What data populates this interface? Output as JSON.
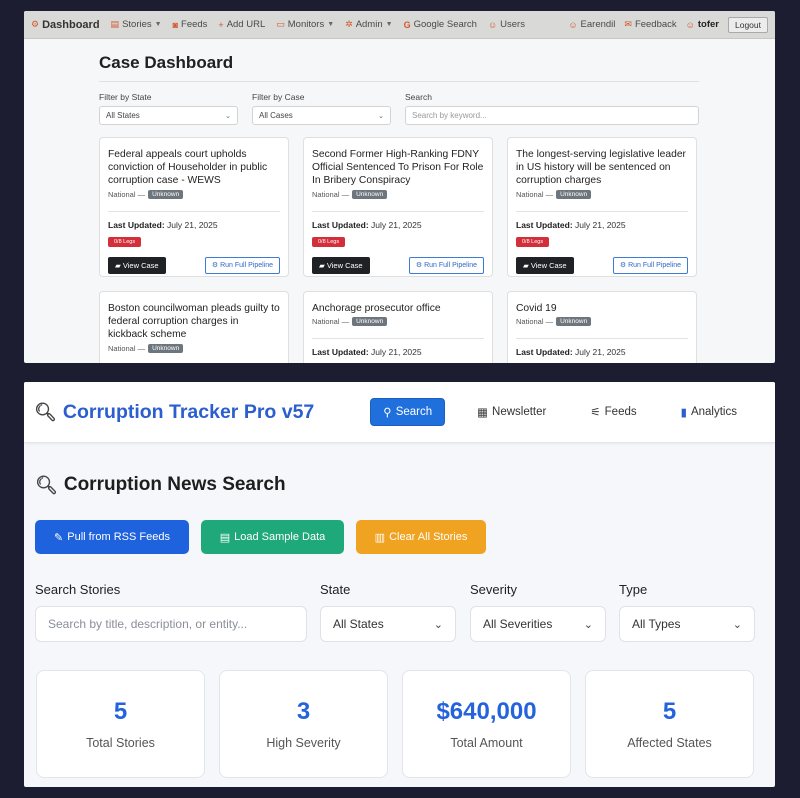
{
  "dashboard": {
    "nav": {
      "brand": "Dashboard",
      "items": [
        {
          "label": "Stories",
          "icon": "stories-icon",
          "dropdown": true
        },
        {
          "label": "Feeds",
          "icon": "rss-icon",
          "dropdown": false
        },
        {
          "label": "Add URL",
          "icon": "plus-icon",
          "dropdown": false
        },
        {
          "label": "Monitors",
          "icon": "monitor-icon",
          "dropdown": true
        },
        {
          "label": "Admin",
          "icon": "gear-icon",
          "dropdown": true
        },
        {
          "label": "Google Search",
          "icon": "google-icon",
          "dropdown": false
        },
        {
          "label": "Users",
          "icon": "users-icon",
          "dropdown": false
        }
      ],
      "right": {
        "user1": "Earendil",
        "feedback": "Feedback",
        "user2": "tofer",
        "logout": "Logout"
      }
    },
    "title": "Case Dashboard",
    "filters": {
      "state_label": "Filter by State",
      "state_value": "All States",
      "case_label": "Filter by Case",
      "case_value": "All Cases",
      "search_label": "Search",
      "search_placeholder": "Search by keyword..."
    },
    "cards": [
      {
        "title": "Federal appeals court upholds conviction of Householder in public corruption case - WEWS",
        "region": "National —",
        "badge": "Unknown",
        "updated_label": "Last Updated:",
        "updated": "July 21, 2025",
        "red_badge": "0/8 Legs",
        "view": "View Case",
        "pipeline": "Run Full Pipeline"
      },
      {
        "title": "Second Former High-Ranking FDNY Official Sentenced To Prison For Role In Bribery Conspiracy",
        "region": "National —",
        "badge": "Unknown",
        "updated_label": "Last Updated:",
        "updated": "July 21, 2025",
        "red_badge": "0/8 Legs",
        "view": "View Case",
        "pipeline": "Run Full Pipeline"
      },
      {
        "title": "The longest-serving legislative leader in US history will be sentenced on corruption charges",
        "region": "National —",
        "badge": "Unknown",
        "updated_label": "Last Updated:",
        "updated": "July 21, 2025",
        "red_badge": "0/8 Legs",
        "view": "View Case",
        "pipeline": "Run Full Pipeline"
      },
      {
        "title": "Boston councilwoman pleads guilty to federal corruption charges in kickback scheme",
        "region": "National —",
        "badge": "Unknown"
      },
      {
        "title": "Anchorage prosecutor office",
        "region": "National —",
        "badge": "Unknown",
        "updated_label": "Last Updated:",
        "updated": "July 21, 2025"
      },
      {
        "title": "Covid 19",
        "region": "National —",
        "badge": "Unknown",
        "updated_label": "Last Updated:",
        "updated": "July 21, 2025"
      }
    ]
  },
  "tracker": {
    "app_title": "Corruption Tracker Pro v57",
    "tabs": [
      {
        "label": "Search",
        "icon": "search-icon",
        "active": true
      },
      {
        "label": "Newsletter",
        "icon": "newspaper-icon",
        "active": false
      },
      {
        "label": "Feeds",
        "icon": "satellite-icon",
        "active": false
      },
      {
        "label": "Analytics",
        "icon": "chart-icon",
        "active": false
      }
    ],
    "section_title": "Corruption News Search",
    "buttons": {
      "pull": "Pull from RSS Feeds",
      "load": "Load Sample Data",
      "clear": "Clear All Stories"
    },
    "filters": {
      "search_label": "Search Stories",
      "search_placeholder": "Search by title, description, or entity...",
      "state_label": "State",
      "state_value": "All States",
      "severity_label": "Severity",
      "severity_value": "All Severities",
      "type_label": "Type",
      "type_value": "All Types"
    },
    "stats": [
      {
        "value": "5",
        "label": "Total Stories"
      },
      {
        "value": "3",
        "label": "High Severity"
      },
      {
        "value": "$640,000",
        "label": "Total Amount"
      },
      {
        "value": "5",
        "label": "Affected States"
      }
    ],
    "colors": {
      "primary": "#1f62dd",
      "success": "#1fa87a",
      "warning": "#f0a221",
      "stat_value": "#2563dc"
    }
  }
}
